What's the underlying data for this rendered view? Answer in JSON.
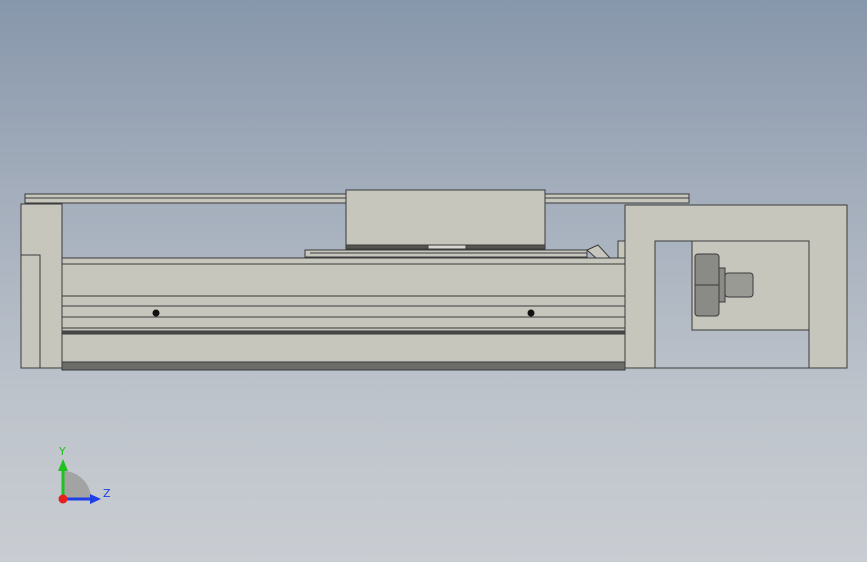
{
  "viewport": {
    "background_top": "#8797ab",
    "background_bottom": "#c9cdd2"
  },
  "model": {
    "part_fill": "#c6c6bd",
    "part_stroke": "#3a3a3a",
    "dark_strip": "#6c6c68",
    "screw_fill": "#8a8a86"
  },
  "triad": {
    "y_label": "Y",
    "z_label": "Z",
    "y_color": "#1fc21f",
    "z_color": "#1f3fe6",
    "x_color": "#e61f1f"
  }
}
